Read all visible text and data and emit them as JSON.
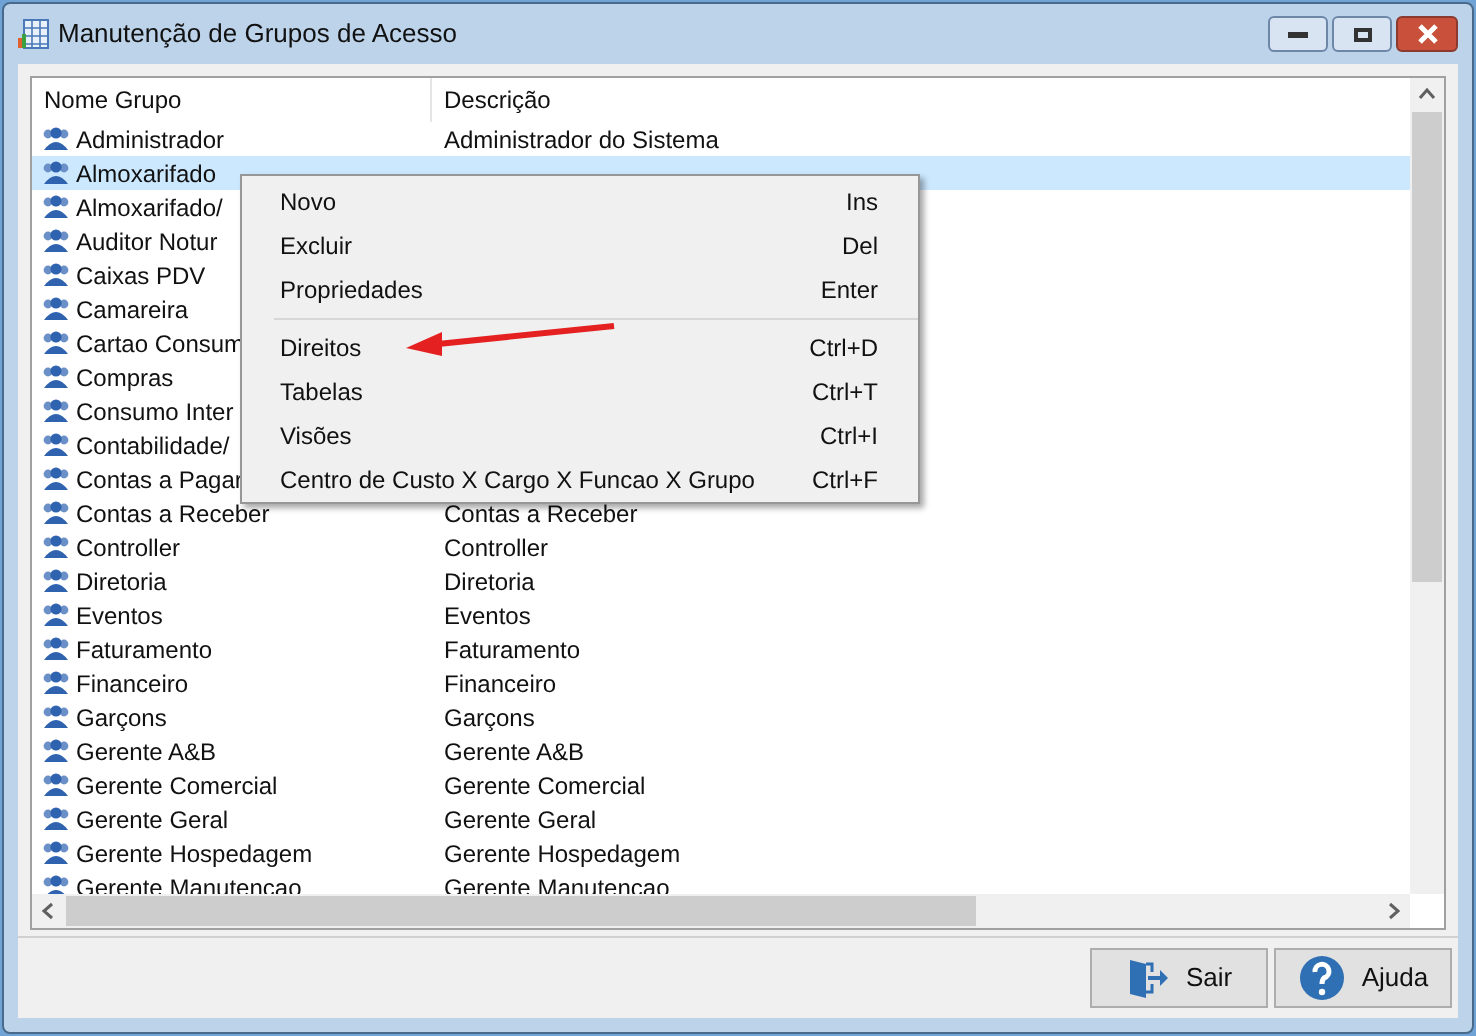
{
  "window": {
    "title": "Manutenção de Grupos de Acesso"
  },
  "table": {
    "columns": [
      "Nome Grupo",
      "Descrição"
    ],
    "rows": [
      {
        "name": "Administrador",
        "description": "Administrador do Sistema",
        "selected": false
      },
      {
        "name": "Almoxarifado",
        "selected": true
      },
      {
        "name": "Almoxarifado/",
        "selected": false
      },
      {
        "name": "Auditor Notur",
        "selected": false
      },
      {
        "name": "Caixas PDV",
        "selected": false
      },
      {
        "name": "Camareira",
        "selected": false
      },
      {
        "name": "Cartao Consum",
        "selected": false
      },
      {
        "name": "Compras",
        "selected": false
      },
      {
        "name": "Consumo Inter",
        "selected": false
      },
      {
        "name": "Contabilidade/",
        "selected": false
      },
      {
        "name": "Contas a Pagar",
        "selected": false
      },
      {
        "name": "Contas a Receber",
        "description": "Contas a Receber",
        "selected": false
      },
      {
        "name": "Controller",
        "description": "Controller",
        "selected": false
      },
      {
        "name": "Diretoria",
        "description": "Diretoria",
        "selected": false
      },
      {
        "name": "Eventos",
        "description": "Eventos",
        "selected": false
      },
      {
        "name": "Faturamento",
        "description": "Faturamento",
        "selected": false
      },
      {
        "name": "Financeiro",
        "description": "Financeiro",
        "selected": false
      },
      {
        "name": "Garçons",
        "description": "Garçons",
        "selected": false
      },
      {
        "name": "Gerente A&B",
        "description": "Gerente A&B",
        "selected": false
      },
      {
        "name": "Gerente Comercial",
        "description": "Gerente Comercial",
        "selected": false
      },
      {
        "name": "Gerente Geral",
        "description": "Gerente Geral",
        "selected": false
      },
      {
        "name": "Gerente Hospedagem",
        "description": "Gerente Hospedagem",
        "selected": false
      },
      {
        "name": "Gerente Manutencao",
        "description": "Gerente Manutencao",
        "selected": false
      }
    ]
  },
  "context_menu": {
    "groups": [
      [
        {
          "label": "Novo",
          "shortcut": "Ins"
        },
        {
          "label": "Excluir",
          "shortcut": "Del"
        },
        {
          "label": "Propriedades",
          "shortcut": "Enter"
        }
      ],
      [
        {
          "label": "Direitos",
          "shortcut": "Ctrl+D"
        },
        {
          "label": "Tabelas",
          "shortcut": "Ctrl+T"
        },
        {
          "label": "Visões",
          "shortcut": "Ctrl+I"
        },
        {
          "label": "Centro de Custo X Cargo X Funcao X Grupo",
          "shortcut": "Ctrl+F"
        }
      ]
    ]
  },
  "buttons": [
    {
      "label": "Sair",
      "kind": "exit"
    },
    {
      "label": "Ajuda",
      "kind": "help"
    }
  ]
}
